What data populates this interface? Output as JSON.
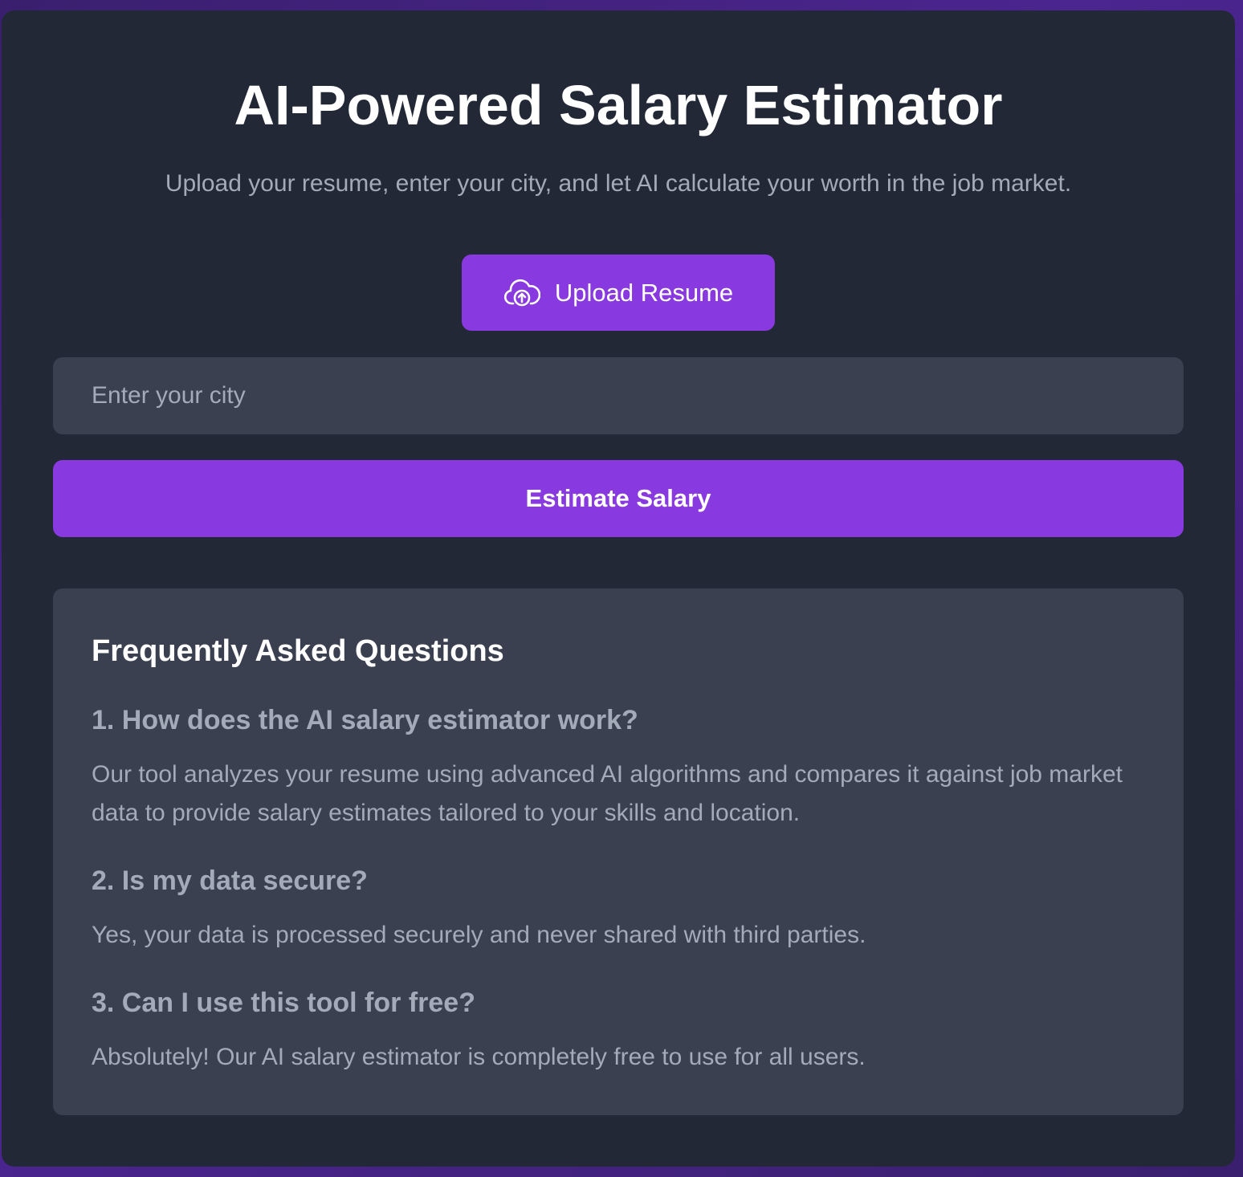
{
  "header": {
    "title": "AI-Powered Salary Estimator",
    "subtitle": "Upload your resume, enter your city, and let AI calculate your worth in the job market."
  },
  "upload": {
    "label": "Upload Resume",
    "icon": "cloud-upload-icon"
  },
  "city": {
    "placeholder": "Enter your city",
    "value": ""
  },
  "estimate": {
    "label": "Estimate Salary"
  },
  "faq": {
    "title": "Frequently Asked Questions",
    "items": [
      {
        "question": "1. How does the AI salary estimator work?",
        "answer": "Our tool analyzes your resume using advanced AI algorithms and compares it against job market data to provide salary estimates tailored to your skills and location."
      },
      {
        "question": "2. Is my data secure?",
        "answer": "Yes, your data is processed securely and never shared with third parties."
      },
      {
        "question": "3. Can I use this tool for free?",
        "answer": "Absolutely! Our AI salary estimator is completely free to use for all users."
      }
    ]
  },
  "colors": {
    "accent": "#8839e0",
    "card_bg": "#222836",
    "panel_bg": "#3a4050",
    "muted_text": "#a3abb9",
    "page_bg": "#4b2590"
  }
}
